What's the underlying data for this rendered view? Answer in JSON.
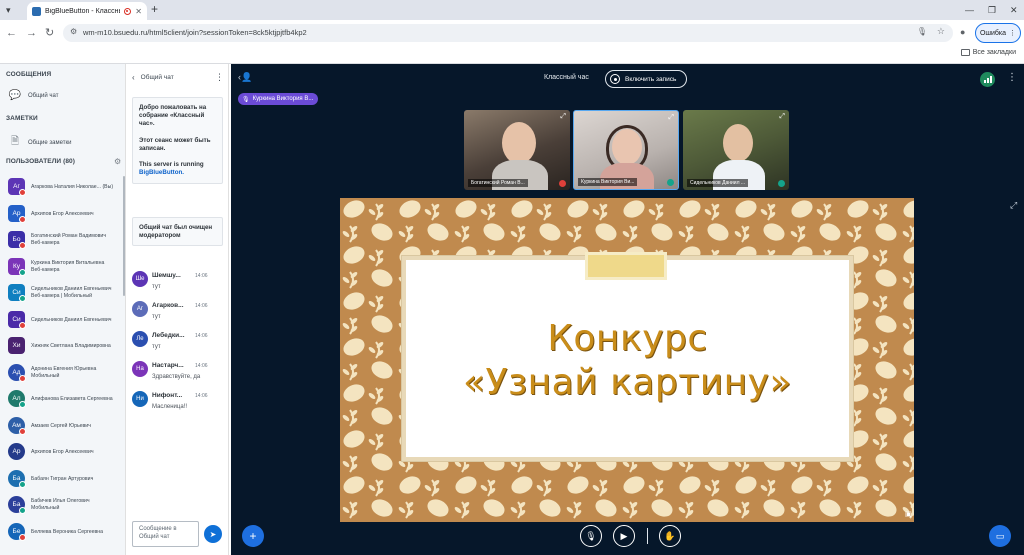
{
  "browser": {
    "tab_title": "BigBlueButton - Классный",
    "url": "wm-m10.bsuedu.ru/html5client/join?sessionToken=8ck5ktjpjtfb4kp2",
    "profile_error_label": "Ошибка",
    "bookmarks_label": "Все закладки"
  },
  "sidebar": {
    "messages_header": "СООБЩЕНИЯ",
    "public_chat_label": "Общий чат",
    "notes_header": "ЗАМЕТКИ",
    "shared_notes_label": "Общие заметки",
    "users_header": "ПОЛЬЗОВАТЕЛИ (80)",
    "users": [
      {
        "initials": "Аг",
        "name": "Агаркова Наталия Николае... (Вы)",
        "sub": "",
        "color": "#5c35b5",
        "shape": "square",
        "badge": "#e0403a"
      },
      {
        "initials": "Ар",
        "name": "Архипов Егор Алексеевич",
        "sub": "",
        "color": "#2460c8",
        "shape": "square",
        "badge": "#e0403a"
      },
      {
        "initials": "Бо",
        "name": "Богатинский Роман Вадимович",
        "sub": "Веб-камера",
        "color": "#3b2ea8",
        "shape": "square",
        "badge": "#e0403a"
      },
      {
        "initials": "Ку",
        "name": "Куркина Виктория Витальевна",
        "sub": "Веб-камера",
        "color": "#7b34b8",
        "shape": "square",
        "badge": "#14a38b"
      },
      {
        "initials": "Си",
        "name": "Сидельников Даниил Евгеньевич",
        "sub": "Веб-камера | Мобильный",
        "color": "#0f7fc0",
        "shape": "square",
        "badge": "#14a38b"
      },
      {
        "initials": "Си",
        "name": "Сидельников Даниил Евгеньевич",
        "sub": "",
        "color": "#4a2aa8",
        "shape": "square",
        "badge": "#e0403a"
      },
      {
        "initials": "Хи",
        "name": "Хижняк Светлана Владимировна",
        "sub": "",
        "color": "#4a2270",
        "shape": "square",
        "badge": ""
      },
      {
        "initials": "Ад",
        "name": "Адонина Евгения Юрьевна",
        "sub": "Мобильный",
        "color": "#2b4fb0",
        "shape": "round",
        "badge": "#e0403a"
      },
      {
        "initials": "Ал",
        "name": "Алифанова Елизавета Сергеевна",
        "sub": "",
        "color": "#1f7a6c",
        "shape": "round",
        "badge": "#14a38b"
      },
      {
        "initials": "Ам",
        "name": "Амзаев Сергей Юрьевич",
        "sub": "",
        "color": "#2d5fa8",
        "shape": "round",
        "badge": "#e0403a"
      },
      {
        "initials": "Ар",
        "name": "Архипов Егор Алексеевич",
        "sub": "",
        "color": "#243a8a",
        "shape": "round",
        "badge": ""
      },
      {
        "initials": "Ба",
        "name": "Бабаян Тигран Артурович",
        "sub": "",
        "color": "#1d6fb0",
        "shape": "round",
        "badge": "#14a38b"
      },
      {
        "initials": "Ба",
        "name": "Бабичев Илья Олегович",
        "sub": "Мобильный",
        "color": "#2b3f9a",
        "shape": "round",
        "badge": "#14a38b"
      },
      {
        "initials": "Бе",
        "name": "Беляева Вероника Сергеевна",
        "sub": "",
        "color": "#1566b8",
        "shape": "round",
        "badge": "#e0403a"
      }
    ]
  },
  "chat": {
    "title": "Общий чат",
    "welcome_line1": "Добро пожаловать на собрание «Классный час».",
    "welcome_line2": "Этот сеанс может быть записан.",
    "welcome_line3": "This server is running",
    "welcome_link": "BigBlueButton.",
    "cleared_notice": "Общий чат был очищен модератором",
    "messages": [
      {
        "initials": "Ше",
        "name": "Шемшу...",
        "time": "14:06",
        "text": "тут",
        "color": "#5c35b5"
      },
      {
        "initials": "Аг",
        "name": "Агарков...",
        "time": "14:06",
        "text": "тут",
        "color": "#5c6cb8"
      },
      {
        "initials": "Ле",
        "name": "Лебедки...",
        "time": "14:06",
        "text": "тут",
        "color": "#2b4fb0"
      },
      {
        "initials": "На",
        "name": "Настарч...",
        "time": "14:06",
        "text": "Здравствуйте, да",
        "color": "#7b34b8"
      },
      {
        "initials": "Ни",
        "name": "Нифонт...",
        "time": "14:06",
        "text": "Масленица!!",
        "color": "#1566b8"
      }
    ],
    "input_placeholder": "Сообщение в Общий чат"
  },
  "meeting": {
    "title": "Классный час",
    "record_label": "Включить запись",
    "talking_user": "Куркина Виктория В...",
    "videos": [
      {
        "name": "Богатинский Роман В...",
        "mic_color": "#e0403a"
      },
      {
        "name": "Куркина Виктория Ви...",
        "mic_color": "#14a38b"
      },
      {
        "name": "Сидельников Даниил ...",
        "mic_color": "#14a38b"
      }
    ],
    "slide_title_line1": "Конкурс",
    "slide_title_line2": "«Узнай картину»"
  }
}
